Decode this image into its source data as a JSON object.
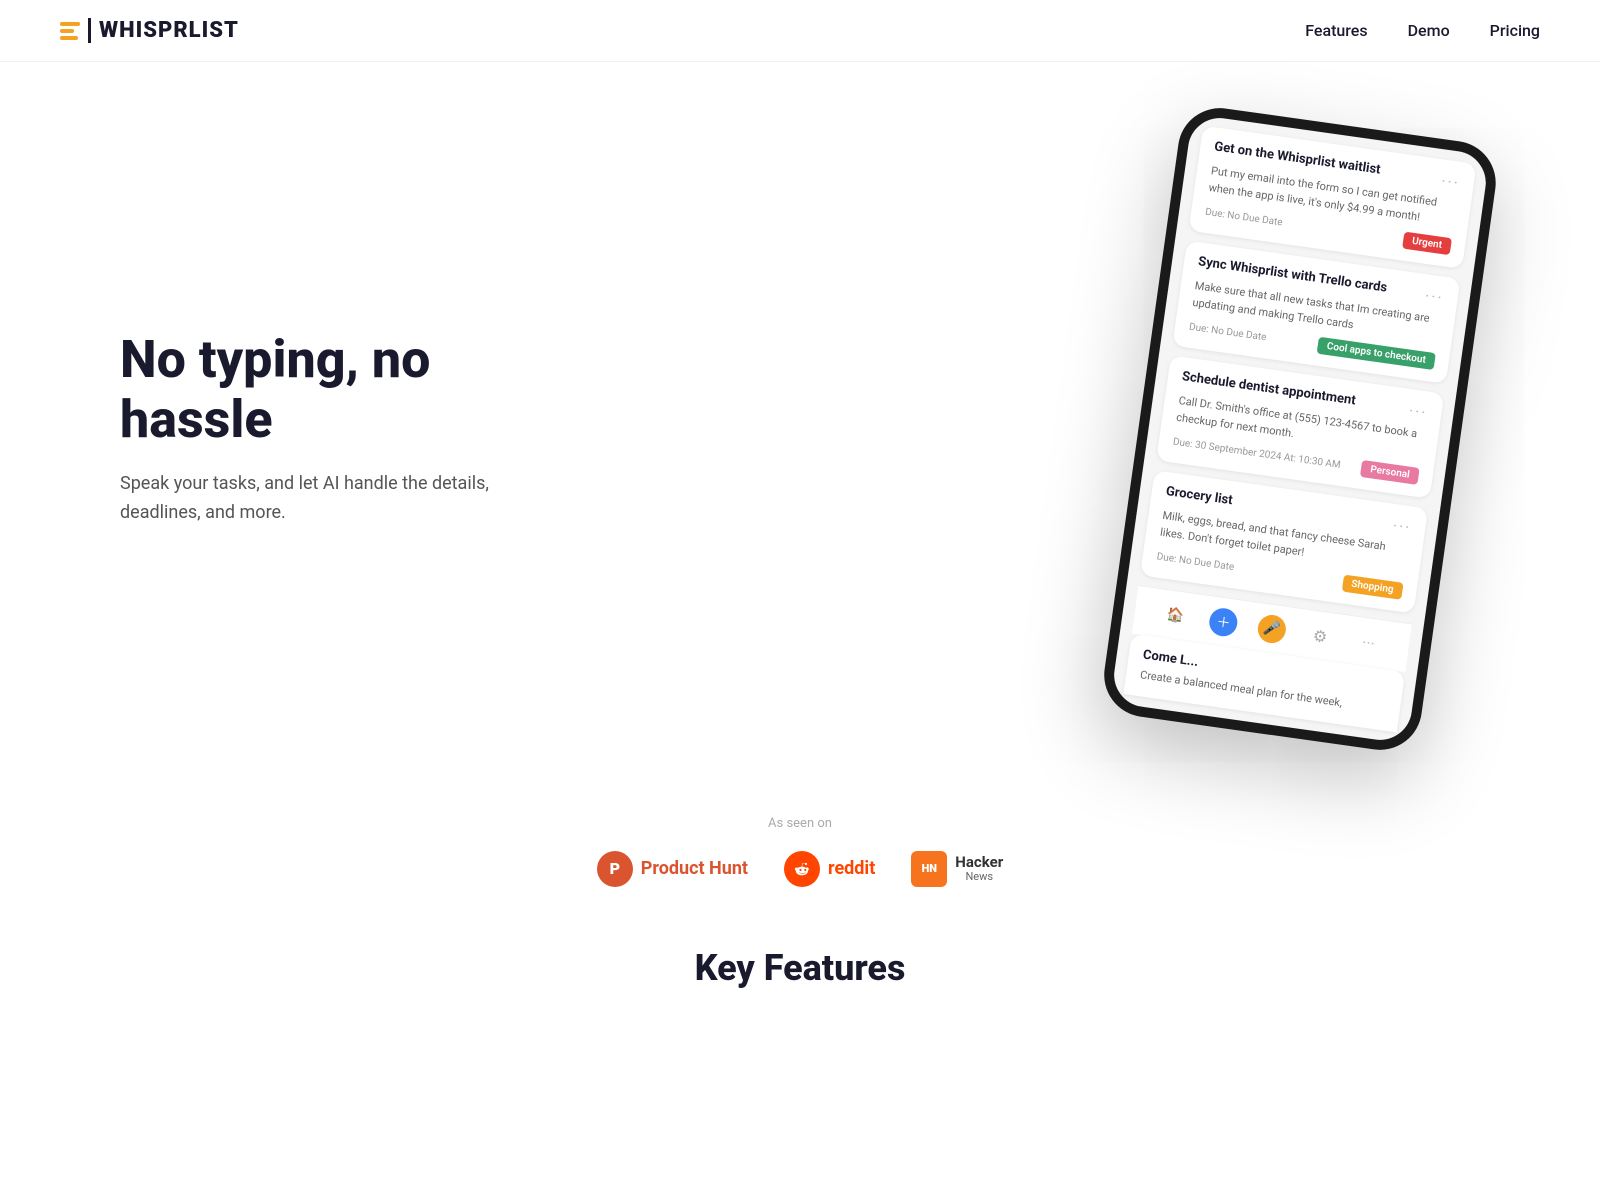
{
  "nav": {
    "logo_text": "WHISPRLIST",
    "links": [
      {
        "label": "Features",
        "href": "#features"
      },
      {
        "label": "Demo",
        "href": "#demo"
      },
      {
        "label": "Pricing",
        "href": "#pricing"
      }
    ]
  },
  "hero": {
    "title": "No typing, no hassle",
    "subtitle": "Speak your tasks, and let AI handle the details, deadlines, and more."
  },
  "phone": {
    "cards": [
      {
        "title": "Get on the Whisprlist waitlist",
        "desc": "Put my email into the form so I can get notified when the app is live, it's only $4.99 a month!",
        "due": "Due: No Due Date",
        "tag": "Urgent",
        "tag_class": "tag-urgent"
      },
      {
        "title": "Sync Whisprlist with Trello cards",
        "desc": "Make sure that all new tasks that Im creating are updating and making Trello cards",
        "due": "Due: No Due Date",
        "tag": "Cool apps to checkout",
        "tag_class": "tag-cool"
      },
      {
        "title": "Schedule dentist appointment",
        "desc": "Call Dr. Smith's office at (555) 123-4567 to book a checkup for next month.",
        "due": "Due: 30 September 2024 At: 10:30 AM",
        "tag": "Personal",
        "tag_class": "tag-personal"
      },
      {
        "title": "Grocery list",
        "desc": "Milk, eggs, bread, and that fancy cheese Sarah likes. Don't forget toilet paper!",
        "due": "Due: No Due Date",
        "tag": "Shopping",
        "tag_class": "tag-shopping"
      }
    ],
    "partial_title": "Come L...",
    "partial_desc": "Create a balanced meal plan for the week,"
  },
  "as_seen_on": {
    "label": "As seen on",
    "platforms": [
      {
        "name": "Product Hunt",
        "icon": "P",
        "icon_class": "icon-ph",
        "name_class": "name-ph"
      },
      {
        "name": "reddit",
        "icon": "r",
        "icon_class": "icon-reddit",
        "name_class": "name-reddit"
      },
      {
        "name1": "Hacker",
        "name2": "News",
        "icon": "HN",
        "icon_class": "icon-hn"
      }
    ]
  },
  "key_features": {
    "title": "Key Features"
  }
}
